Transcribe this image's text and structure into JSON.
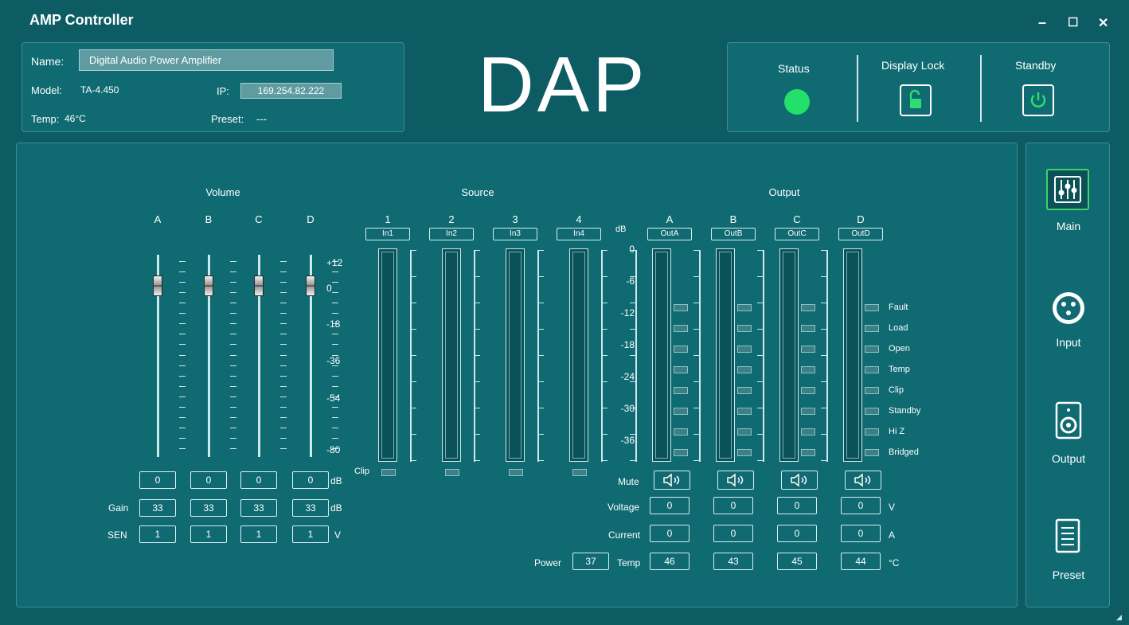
{
  "window": {
    "title": "AMP Controller",
    "minimize": "–",
    "maximize": "☐",
    "close": "✕"
  },
  "info": {
    "name_label": "Name:",
    "name_value": "Digital Audio Power Amplifier",
    "model_label": "Model:",
    "model_value": "TA-4.450",
    "ip_label": "IP:",
    "ip_value": "169.254.82.222",
    "temp_label": "Temp:",
    "temp_value": "46°C",
    "preset_label": "Preset:",
    "preset_value": "---"
  },
  "logo": "DAP",
  "status": {
    "status_label": "Status",
    "lock_label": "Display Lock",
    "standby_label": "Standby",
    "status_color": "#22e06a",
    "accent": "#2fdc6f"
  },
  "volume": {
    "title": "Volume",
    "channels": [
      "A",
      "B",
      "C",
      "D"
    ],
    "scale": [
      "+12",
      "0",
      "-18",
      "-36",
      "-54",
      "-80"
    ],
    "db_values": [
      "0",
      "0",
      "0",
      "0"
    ],
    "db_unit": "dB",
    "gain_label": "Gain",
    "gain_values": [
      "33",
      "33",
      "33",
      "33"
    ],
    "gain_unit": "dB",
    "sen_label": "SEN",
    "sen_values": [
      "1",
      "1",
      "1",
      "1"
    ],
    "sen_unit": "V"
  },
  "source": {
    "title": "Source",
    "channels": [
      "1",
      "2",
      "3",
      "4"
    ],
    "tags": [
      "In1",
      "In2",
      "In3",
      "In4"
    ],
    "clip_label": "Clip"
  },
  "db_scale": {
    "unit": "dB",
    "marks": [
      "0",
      "-6",
      "-12",
      "-18",
      "-24",
      "-30",
      "-36"
    ]
  },
  "output": {
    "title": "Output",
    "channels": [
      "A",
      "B",
      "C",
      "D"
    ],
    "tags": [
      "OutA",
      "OutB",
      "OutC",
      "OutD"
    ],
    "status_labels": [
      "Fault",
      "Load",
      "Open",
      "Temp",
      "Clip",
      "Standby",
      "Hi Z",
      "Bridged"
    ],
    "mute_label": "Mute",
    "voltage_label": "Voltage",
    "voltage_values": [
      "0",
      "0",
      "0",
      "0"
    ],
    "voltage_unit": "V",
    "current_label": "Current",
    "current_values": [
      "0",
      "0",
      "0",
      "0"
    ],
    "current_unit": "A",
    "power_label": "Power",
    "power_value": "37",
    "temp_label": "Temp",
    "temp_values": [
      "46",
      "43",
      "45",
      "44"
    ],
    "temp_unit": "°C"
  },
  "nav": {
    "items": [
      {
        "label": "Main",
        "icon": "sliders-icon"
      },
      {
        "label": "Input",
        "icon": "xlr-connector-icon"
      },
      {
        "label": "Output",
        "icon": "speaker-icon"
      },
      {
        "label": "Preset",
        "icon": "document-icon"
      }
    ]
  }
}
